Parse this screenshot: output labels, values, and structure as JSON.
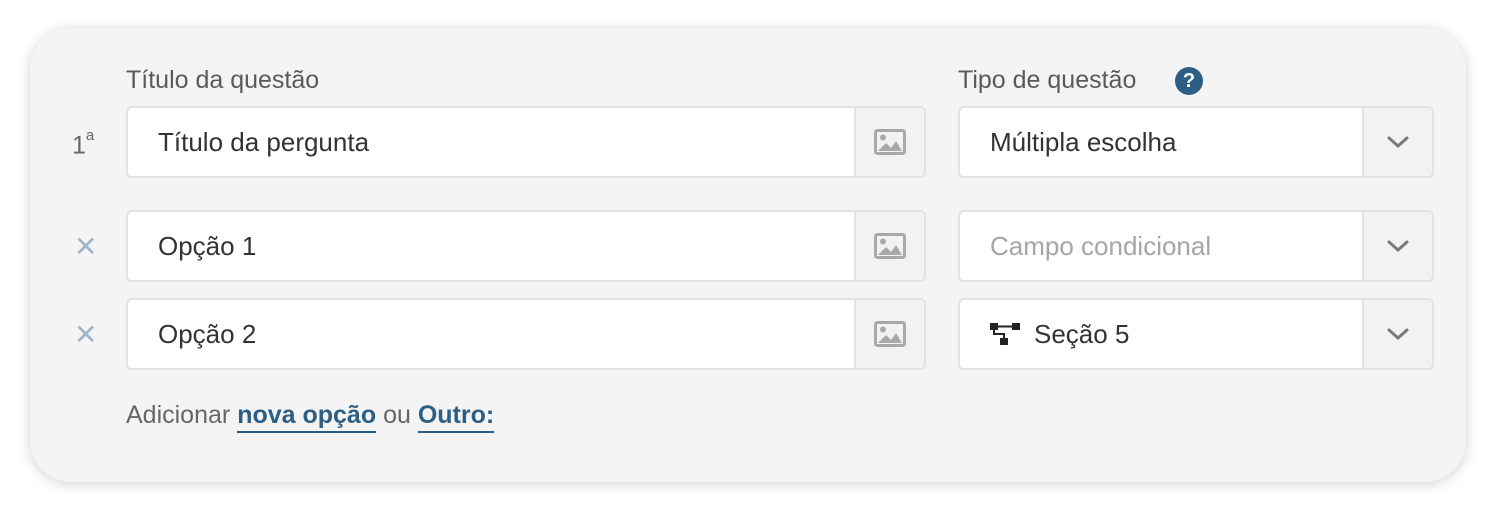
{
  "question": {
    "title_label": "Título da questão",
    "type_label": "Tipo de questão",
    "help_glyph": "?",
    "number": "1",
    "number_suffix": "a",
    "title_value": "Título da pergunta",
    "type_value": "Múltipla escolha"
  },
  "options": [
    {
      "value": "Opção 1",
      "condition_placeholder": "Campo condicional",
      "condition_value": ""
    },
    {
      "value": "Opção 2",
      "condition_placeholder": "",
      "condition_value": "Seção 5"
    }
  ],
  "remove_glyph": "✕",
  "footer": {
    "prefix": "Adicionar",
    "new_option_link": "nova opção",
    "or": "ou",
    "other_link": "Outro:"
  },
  "colors": {
    "accent": "#2d5f86",
    "remove": "#9db6c7",
    "card_bg": "#f4f4f4"
  },
  "icons": {
    "image_addon": "image-icon",
    "dropdown": "chevron-down-icon",
    "help": "question-circle-icon",
    "branch": "sitemap-icon"
  }
}
